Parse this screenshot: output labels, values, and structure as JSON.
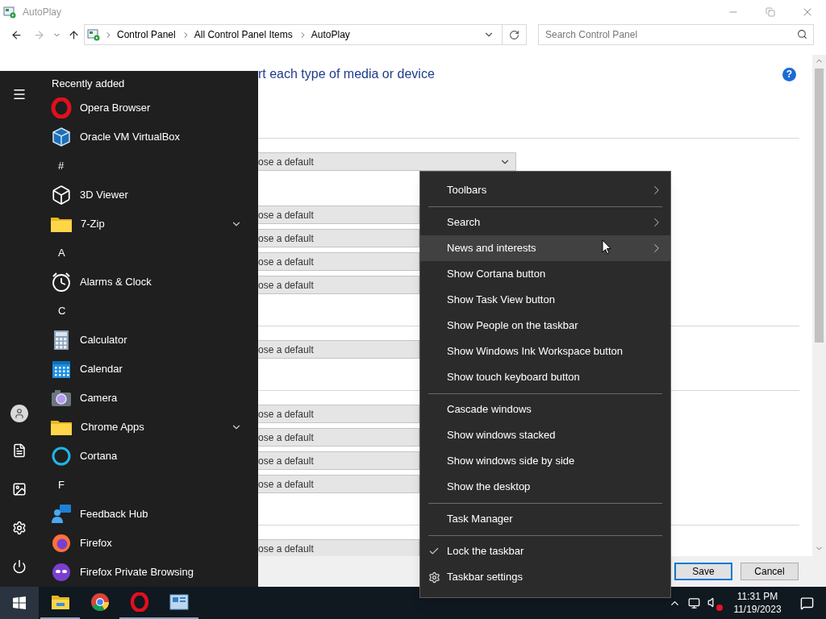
{
  "window": {
    "title": "AutoPlay",
    "breadcrumb": [
      "Control Panel",
      "All Control Panel Items",
      "AutoPlay"
    ],
    "search": {
      "placeholder": "Search Control Panel"
    }
  },
  "content": {
    "heading": "rt each type of media or device",
    "help": "?",
    "sections": [
      {
        "groups": [
          [
            "ose a default"
          ],
          [
            "ose a default",
            "ose a default",
            "ose a default",
            "ose a default"
          ]
        ]
      },
      {
        "groups": [
          [
            "ose a default"
          ]
        ]
      },
      {
        "groups": [
          [
            "ose a default",
            "ose a default",
            "ose a default",
            "ose a default"
          ]
        ]
      },
      {
        "groups": [
          [
            "ose a default"
          ]
        ]
      }
    ]
  },
  "buttons": [
    {
      "label": "Save",
      "default": true
    },
    {
      "label": "Cancel",
      "default": false
    }
  ],
  "start_menu": {
    "heading": "Recently added",
    "entries": [
      {
        "kind": "app",
        "label": "Opera Browser"
      },
      {
        "kind": "app",
        "label": "Oracle VM VirtualBox"
      },
      {
        "kind": "letter",
        "label": "#"
      },
      {
        "kind": "app",
        "label": "3D Viewer"
      },
      {
        "kind": "folder",
        "label": "7-Zip",
        "expanded": false
      },
      {
        "kind": "letter",
        "label": "A"
      },
      {
        "kind": "app",
        "label": "Alarms & Clock"
      },
      {
        "kind": "letter",
        "label": "C"
      },
      {
        "kind": "app",
        "label": "Calculator"
      },
      {
        "kind": "app",
        "label": "Calendar"
      },
      {
        "kind": "app",
        "label": "Camera"
      },
      {
        "kind": "folder",
        "label": "Chrome Apps",
        "expanded": false
      },
      {
        "kind": "app",
        "label": "Cortana"
      },
      {
        "kind": "letter",
        "label": "F"
      },
      {
        "kind": "app",
        "label": "Feedback Hub"
      },
      {
        "kind": "app",
        "label": "Firefox"
      },
      {
        "kind": "app",
        "label": "Firefox Private Browsing"
      }
    ]
  },
  "context_menu": {
    "items": [
      {
        "kind": "item",
        "label": "Toolbars",
        "submenu": true,
        "checked": false,
        "selected": false
      },
      {
        "kind": "separator"
      },
      {
        "kind": "item",
        "label": "Search",
        "submenu": true,
        "checked": false,
        "selected": false
      },
      {
        "kind": "item",
        "label": "News and interests",
        "submenu": true,
        "checked": false,
        "selected": true
      },
      {
        "kind": "item",
        "label": "Show Cortana button",
        "submenu": false,
        "checked": false,
        "selected": false
      },
      {
        "kind": "item",
        "label": "Show Task View button",
        "submenu": false,
        "checked": false,
        "selected": false
      },
      {
        "kind": "item",
        "label": "Show People on the taskbar",
        "submenu": false,
        "checked": false,
        "selected": false
      },
      {
        "kind": "item",
        "label": "Show Windows Ink Workspace button",
        "submenu": false,
        "checked": false,
        "selected": false
      },
      {
        "kind": "item",
        "label": "Show touch keyboard button",
        "submenu": false,
        "checked": false,
        "selected": false
      },
      {
        "kind": "separator"
      },
      {
        "kind": "item",
        "label": "Cascade windows",
        "submenu": false,
        "checked": false,
        "selected": false
      },
      {
        "kind": "item",
        "label": "Show windows stacked",
        "submenu": false,
        "checked": false,
        "selected": false
      },
      {
        "kind": "item",
        "label": "Show windows side by side",
        "submenu": false,
        "checked": false,
        "selected": false
      },
      {
        "kind": "item",
        "label": "Show the desktop",
        "submenu": false,
        "checked": false,
        "selected": false
      },
      {
        "kind": "separator"
      },
      {
        "kind": "item",
        "label": "Task Manager",
        "submenu": false,
        "checked": false,
        "selected": false
      },
      {
        "kind": "separator"
      },
      {
        "kind": "item",
        "label": "Lock the taskbar",
        "submenu": false,
        "checked": true,
        "selected": false
      },
      {
        "kind": "settings",
        "label": "Taskbar settings",
        "submenu": false,
        "checked": false,
        "selected": false
      }
    ]
  },
  "taskbar": {
    "apps": [
      {
        "running": true
      },
      {
        "running": false
      },
      {
        "running": true
      },
      {
        "running": true
      }
    ],
    "clock": {
      "time": "11:31 PM",
      "date": "11/19/2023"
    }
  }
}
